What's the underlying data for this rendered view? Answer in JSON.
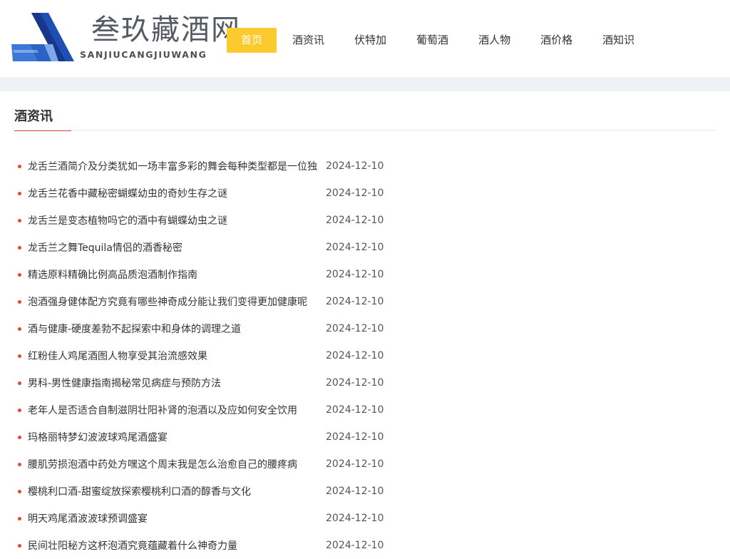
{
  "logo": {
    "name_cn": "叁玖藏酒网",
    "name_en": "SANJIUCANGJIUWANG"
  },
  "nav": {
    "items": [
      {
        "label": "首页",
        "active": true
      },
      {
        "label": "酒资讯",
        "active": false
      },
      {
        "label": "伏特加",
        "active": false
      },
      {
        "label": "葡萄酒",
        "active": false
      },
      {
        "label": "酒人物",
        "active": false
      },
      {
        "label": "酒价格",
        "active": false
      },
      {
        "label": "酒知识",
        "active": false
      }
    ]
  },
  "section": {
    "title": "酒资讯"
  },
  "articles": [
    {
      "title": "龙舌兰酒简介及分类犹如一场丰富多彩的舞会每种类型都是一位独",
      "date": "2024-12-10"
    },
    {
      "title": "龙舌兰花香中藏秘密蝴蝶幼虫的奇妙生存之谜",
      "date": "2024-12-10"
    },
    {
      "title": "龙舌兰是变态植物吗它的酒中有蝴蝶幼虫之谜",
      "date": "2024-12-10"
    },
    {
      "title": "龙舌兰之舞Tequila情侣的酒香秘密",
      "date": "2024-12-10"
    },
    {
      "title": "精选原料精确比例高品质泡酒制作指南",
      "date": "2024-12-10"
    },
    {
      "title": "泡酒强身健体配方究竟有哪些神奇成分能让我们变得更加健康呢",
      "date": "2024-12-10"
    },
    {
      "title": "酒与健康-硬度差勃不起探索中和身体的调理之道",
      "date": "2024-12-10"
    },
    {
      "title": "红粉佳人鸡尾酒图人物享受其治流感效果",
      "date": "2024-12-10"
    },
    {
      "title": "男科-男性健康指南揭秘常见病症与预防方法",
      "date": "2024-12-10"
    },
    {
      "title": "老年人是否适合自制滋阴壮阳补肾的泡酒以及应如何安全饮用",
      "date": "2024-12-10"
    },
    {
      "title": "玛格丽特梦幻波波球鸡尾酒盛宴",
      "date": "2024-12-10"
    },
    {
      "title": "腰肌劳损泡酒中药处方嘿这个周末我是怎么治愈自己的腰疼病",
      "date": "2024-12-10"
    },
    {
      "title": "樱桃利口酒-甜蜜绽放探索樱桃利口酒的醇香与文化",
      "date": "2024-12-10"
    },
    {
      "title": "明天鸡尾酒波波球预调盛宴",
      "date": "2024-12-10"
    },
    {
      "title": "民间壮阳秘方这杯泡酒究竟蕴藏着什么神奇力量",
      "date": "2024-12-10"
    }
  ],
  "colors": {
    "accent_yellow": "#fbcb2e",
    "accent_red": "#e2463b",
    "logo_blue": "#1e4fb0",
    "band_bg": "#eef2f7"
  }
}
